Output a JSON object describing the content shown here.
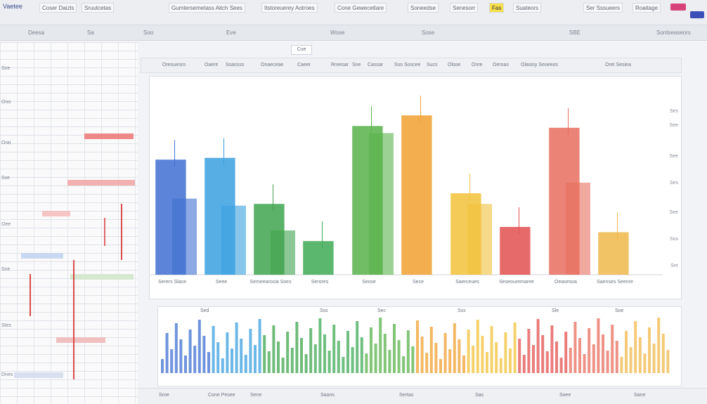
{
  "app": {
    "logo_text": "Vaetee"
  },
  "top_tabs": [
    "Coser Daizls",
    "Sruutcetas",
    "Gumtersemetass Aitch Sees",
    "Itstoreuerey Aotroes",
    "Cone Gewecetlare",
    "Soneedse",
    "Senesorr",
    "Fas",
    "Suateors",
    "Ser Sssueers",
    "Roaitage"
  ],
  "ribbon_items": [
    "Deesa",
    "Sa",
    "Soo",
    "Eve",
    "Wose",
    "Sose",
    "SBE",
    "Sontseaseors"
  ],
  "sheet_labels": [
    "Sne",
    "Ono",
    "Orai",
    "Sse",
    "Oee",
    "Sne",
    "Stes",
    "Dnes"
  ],
  "toolbar_items": [
    "Oreouesro",
    "Oaent",
    "Ssaosss",
    "Onaeceae",
    "Caeer",
    "Rreesar",
    "Sne",
    "Cassar",
    "Sso Soscee",
    "Sucs",
    "Olsoe",
    "Onre",
    "Oeroas",
    "Olasioy Seoeeos",
    "Oret Sesiea"
  ],
  "chart_tab": "Cue",
  "chart_data": {
    "type": "bar",
    "categories": [
      "Serers Slace",
      "Seee",
      "Semeearocia Soes",
      "Serores",
      "Seose",
      "Sece",
      "Saerceues",
      "Seseouremaree",
      "Oeasesoa",
      "Saenses Seenre"
    ],
    "ylim": [
      0,
      100
    ],
    "series": [
      {
        "values": [
          65,
          66,
          40,
          19,
          84,
          90,
          46,
          27,
          83,
          24
        ]
      },
      {
        "values": [
          43,
          39,
          25,
          0,
          80,
          0,
          40,
          0,
          52,
          0
        ]
      }
    ],
    "colors": [
      "#3f6fd1",
      "#3aa0e0",
      "#3fa44e",
      "#3faa55",
      "#58b24a",
      "#f0a030",
      "#f2c23a",
      "#e35050",
      "#e86e5e",
      "#f0b84a"
    ]
  },
  "y_ticks": [
    "Ses",
    "See",
    "See",
    "Ses",
    "See",
    "Sos",
    "Sre"
  ],
  "sub_chart": {
    "labels": [
      "Sed",
      "Sss",
      "Sec",
      "Sss",
      "Sle",
      "Soe"
    ]
  },
  "status_items": [
    "Sroe",
    "Cone Pesee",
    "Sene",
    "Saans",
    "Sertas",
    "Sas",
    "Soee",
    "Sane"
  ],
  "colors": {
    "blue": "#3f6fd1",
    "green": "#3fa44e",
    "orange": "#f0a030",
    "red": "#e35050"
  }
}
